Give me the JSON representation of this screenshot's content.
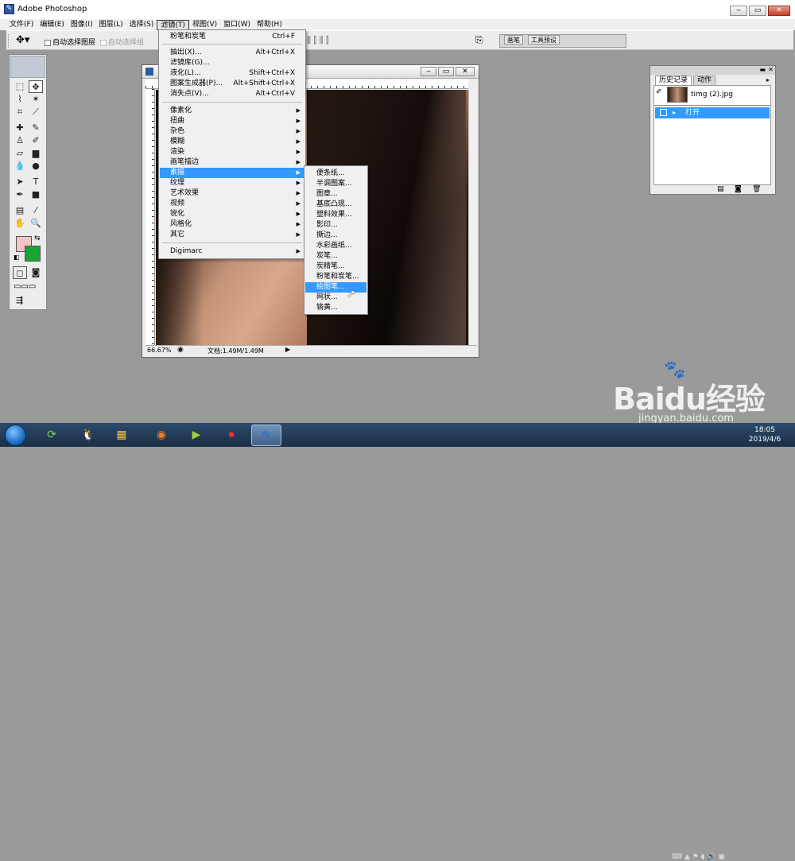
{
  "window": {
    "title": "Adobe Photoshop"
  },
  "menubar": {
    "items": [
      "文件(F)",
      "编辑(E)",
      "图像(I)",
      "图层(L)",
      "选择(S)",
      "滤镜(T)",
      "视图(V)",
      "窗口(W)",
      "帮助(H)"
    ],
    "active_index": 5
  },
  "options": {
    "auto_select_layer": "自动选择图层",
    "auto_select_group": "自动选择组"
  },
  "palette_well": {
    "tabs": [
      "画笔",
      "工具预设"
    ]
  },
  "filter_menu": {
    "items": [
      {
        "label": "粉笔和炭笔",
        "shortcut": "Ctrl+F"
      },
      {
        "label": "抽出(X)...",
        "shortcut": "Alt+Ctrl+X"
      },
      {
        "label": "滤镜库(G)...",
        "shortcut": ""
      },
      {
        "label": "液化(L)...",
        "shortcut": "Shift+Ctrl+X"
      },
      {
        "label": "图案生成器(P)...",
        "shortcut": "Alt+Shift+Ctrl+X"
      },
      {
        "label": "消失点(V)...",
        "shortcut": "Alt+Ctrl+V"
      },
      {
        "label": "像素化",
        "submenu": true
      },
      {
        "label": "扭曲",
        "submenu": true
      },
      {
        "label": "杂色",
        "submenu": true
      },
      {
        "label": "模糊",
        "submenu": true
      },
      {
        "label": "渲染",
        "submenu": true
      },
      {
        "label": "画笔描边",
        "submenu": true
      },
      {
        "label": "素描",
        "submenu": true,
        "highlighted": true
      },
      {
        "label": "纹理",
        "submenu": true
      },
      {
        "label": "艺术效果",
        "submenu": true
      },
      {
        "label": "视频",
        "submenu": true
      },
      {
        "label": "锐化",
        "submenu": true
      },
      {
        "label": "风格化",
        "submenu": true
      },
      {
        "label": "其它",
        "submenu": true
      },
      {
        "label": "Digimarc",
        "submenu": true
      }
    ]
  },
  "sketch_menu": {
    "items": [
      "便条纸...",
      "半调图案...",
      "图章...",
      "基底凸现...",
      "塑料效果...",
      "影印...",
      "撕边...",
      "水彩画纸...",
      "炭笔...",
      "炭精笔...",
      "粉笔和炭笔...",
      "绘图笔...",
      "网状...",
      "铬黄..."
    ],
    "highlighted_index": 11
  },
  "document": {
    "zoom": "66.67%",
    "doc_info": "文档:1.49M/1.49M"
  },
  "history": {
    "tabs": [
      "历史记录",
      "动作"
    ],
    "snapshot": "timg (2).jpg",
    "steps": [
      "打开"
    ]
  },
  "taskbar": {
    "time": "18:05",
    "date": "2019/4/6"
  },
  "watermark": {
    "brand": "Baidu经验",
    "url": "jingyan.baidu.com"
  },
  "colors": {
    "foreground": "#f2c4c4",
    "background": "#1aa533",
    "highlight": "#3399ff"
  }
}
